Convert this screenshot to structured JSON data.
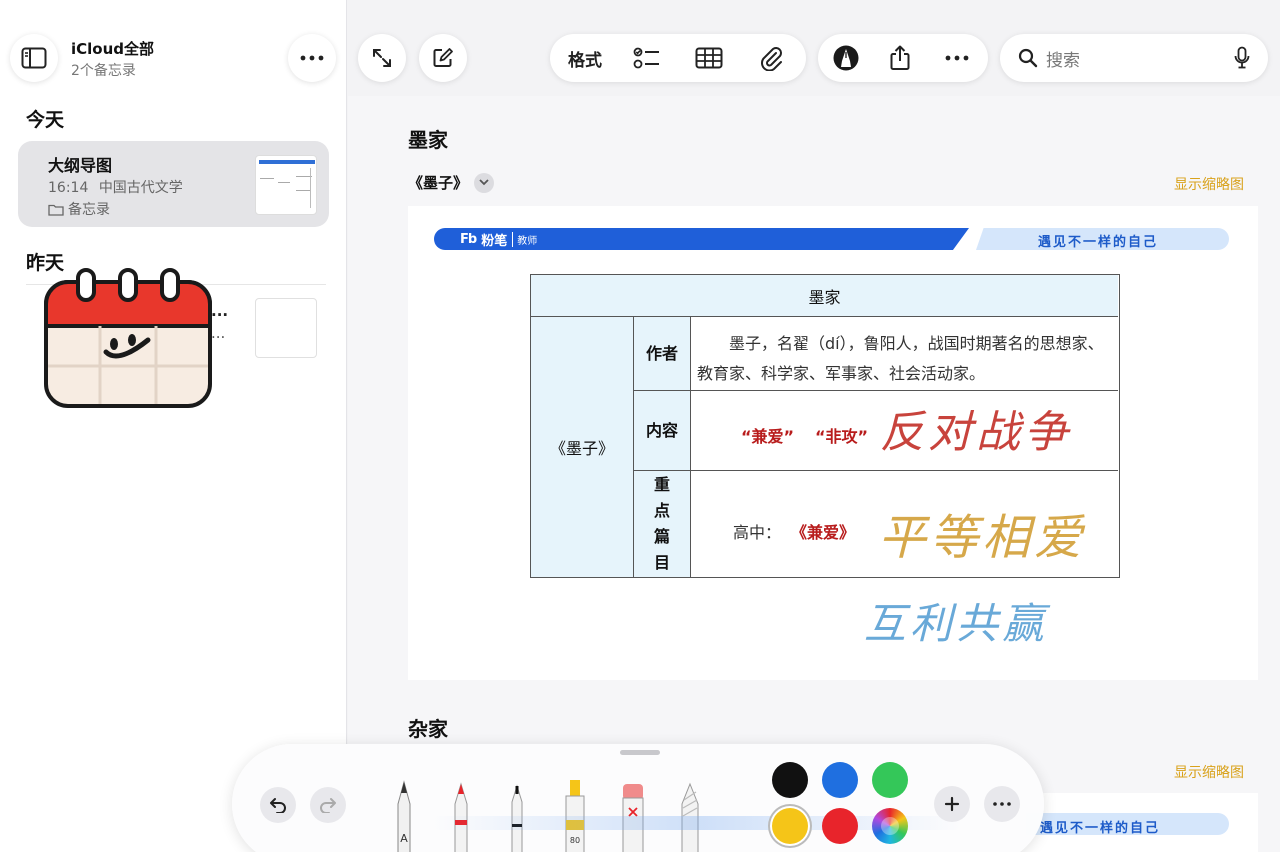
{
  "sidebar": {
    "account_title": "iCloud全部",
    "account_sub": "2个备忘录",
    "today_header": "今天",
    "yesterday_header": "昨天",
    "notes": [
      {
        "title": "大纲导图",
        "time": "16:14",
        "preview": "中国古代文学",
        "folder": "备忘录"
      }
    ],
    "note2_text": [
      "...",
      "..."
    ]
  },
  "toolbar": {
    "format_label": "格式",
    "search_placeholder": "搜索"
  },
  "note": {
    "heading1": "墨家",
    "sub1": "《墨子》",
    "show_thumbnail": "显示缩略图",
    "doc": {
      "brand": "粉笔",
      "brand_tag": "教师",
      "slogan": "遇见不一样的自己",
      "table": {
        "header": "墨家",
        "left_label": "《墨子》",
        "rows": [
          {
            "label": "作者",
            "value": "墨子，名翟（dí），鲁阳人，战国时期著名的思想家、教育家、科学家、军事家、社会活动家。"
          },
          {
            "label": "内容",
            "value_parts": [
              "“兼爱”",
              "“非攻”"
            ]
          },
          {
            "label": "重点篇目",
            "value_prefix": "高中：",
            "value_red": "《兼爱》"
          }
        ]
      },
      "handwriting": {
        "content": "反对战争",
        "focus": "平等相爱",
        "below": "互利共赢"
      }
    },
    "heading2": "杂家",
    "show_thumbnail2": "显示缩略图",
    "slogan2": "遇见不一样的自己"
  },
  "palette": {
    "tools": [
      "pencil-a",
      "pen-red",
      "fineliner",
      "highlighter-80",
      "eraser",
      "crayon"
    ],
    "colors": [
      "#111111",
      "#1f6fe0",
      "#34c759",
      "#f5c518",
      "#e8242b",
      "rainbow"
    ],
    "selected_color": "#f5c518"
  },
  "colors": {
    "accent_yellow": "#d9a21b",
    "banner_blue": "#1f5fd9",
    "hw_red": "#c8433c",
    "hw_yellow": "#d6a84a",
    "hw_blue": "#69a9d8"
  }
}
